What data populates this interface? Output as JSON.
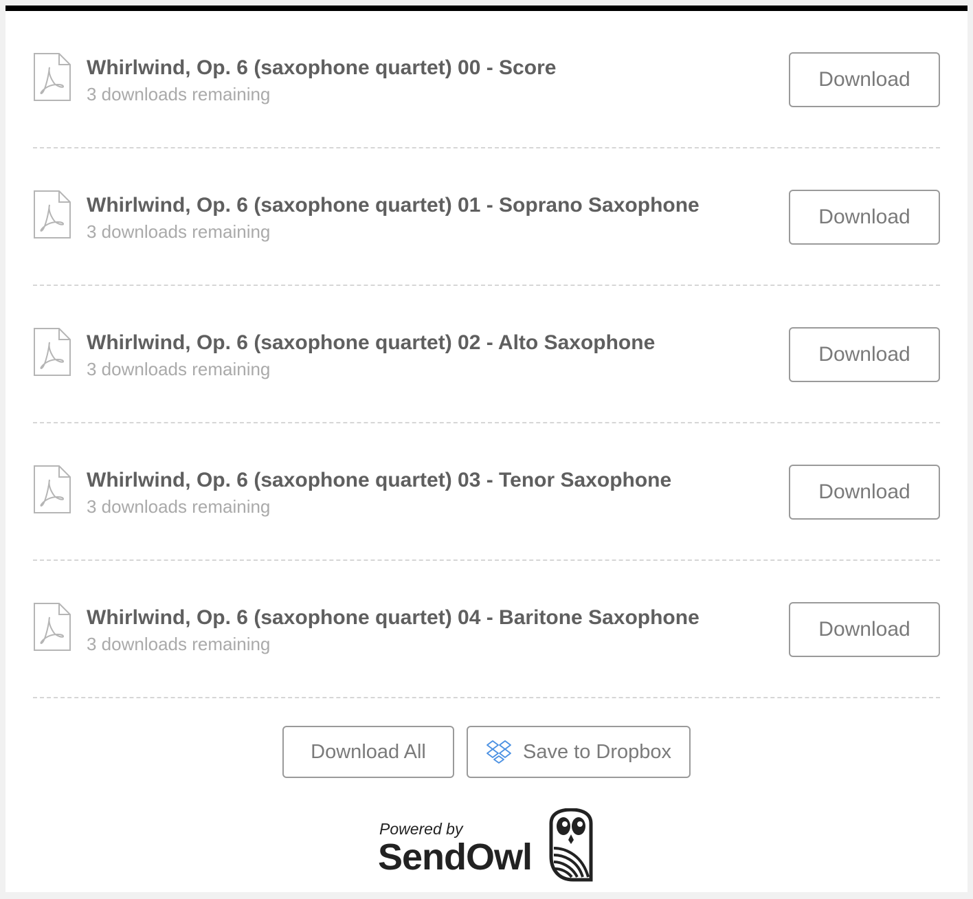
{
  "files": [
    {
      "title": "Whirlwind, Op. 6 (saxophone quartet) 00 - Score",
      "remaining": "3 downloads remaining",
      "button": "Download",
      "icon": "pdf-file-icon"
    },
    {
      "title": "Whirlwind, Op. 6 (saxophone quartet) 01 - Soprano Saxophone",
      "remaining": "3 downloads remaining",
      "button": "Download",
      "icon": "pdf-file-icon"
    },
    {
      "title": "Whirlwind, Op. 6 (saxophone quartet) 02 - Alto Saxophone",
      "remaining": "3 downloads remaining",
      "button": "Download",
      "icon": "pdf-file-icon"
    },
    {
      "title": "Whirlwind, Op. 6 (saxophone quartet) 03 - Tenor Saxophone",
      "remaining": "3 downloads remaining",
      "button": "Download",
      "icon": "pdf-file-icon"
    },
    {
      "title": "Whirlwind, Op. 6 (saxophone quartet) 04 - Baritone Saxophone",
      "remaining": "3 downloads remaining",
      "button": "Download",
      "icon": "pdf-file-icon"
    }
  ],
  "actions": {
    "download_all": "Download All",
    "save_dropbox": "Save to Dropbox",
    "dropbox_icon": "dropbox-icon"
  },
  "footer": {
    "powered_by": "Powered by",
    "brand": "SendOwl",
    "logo_icon": "owl-logo-icon"
  },
  "colors": {
    "top_bar": "#000000",
    "title_text": "#5f5f5f",
    "subtitle_text": "#aaaaaa",
    "button_border": "#9a9a9a",
    "dropbox_blue": "#4a90e2"
  }
}
